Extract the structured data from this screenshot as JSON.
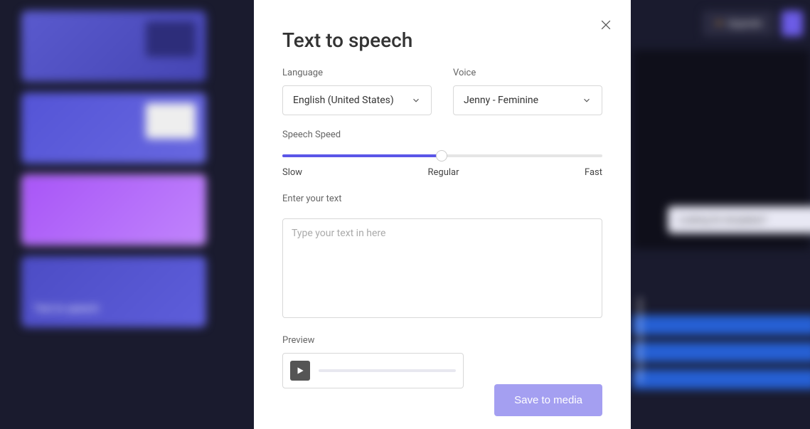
{
  "topbar": {
    "upgrade_label": "Upgrade"
  },
  "sidebar": {
    "cards": [
      {
        "label": ""
      },
      {
        "label": ""
      },
      {
        "label": ""
      },
      {
        "label": "Text to speech"
      }
    ]
  },
  "modal": {
    "title": "Text to speech",
    "language_label": "Language",
    "language_value": "English (United States)",
    "voice_label": "Voice",
    "voice_value": "Jenny - Feminine",
    "speed_label": "Speech Speed",
    "speed_slow": "Slow",
    "speed_regular": "Regular",
    "speed_fast": "Fast",
    "text_label": "Enter your text",
    "text_placeholder": "Type your text in here",
    "text_value": "",
    "preview_label": "Preview",
    "save_label": "Save to media"
  }
}
